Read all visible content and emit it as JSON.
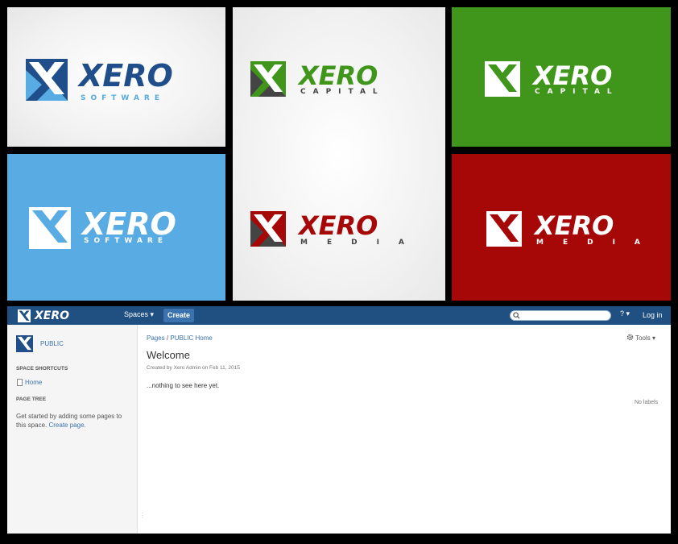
{
  "logos": {
    "p1": {
      "word": "XERO",
      "sub": "SOFTWARE"
    },
    "p2a": {
      "word": "XERO",
      "sub": "CAPITAL"
    },
    "p2b": {
      "word": "XERO",
      "sub": "MEDIA"
    },
    "p3": {
      "word": "XERO",
      "sub": "CAPITAL"
    },
    "p4": {
      "word": "XERO",
      "sub": "SOFTWARE"
    },
    "p6": {
      "word": "XERO",
      "sub": "MEDIA"
    }
  },
  "colors": {
    "navy": "#1f4e8b",
    "sky": "#58abe3",
    "green": "#3f961a",
    "red": "#a50807",
    "gray": "#444444",
    "bar": "#205081"
  },
  "app": {
    "brand": "XERO",
    "nav": {
      "spaces": "Spaces ▾",
      "create": "Create",
      "help": "? ▾",
      "login": "Log in"
    },
    "search": {
      "placeholder": ""
    },
    "sidebar": {
      "space_name": "PUBLIC",
      "shortcuts_heading": "SPACE SHORTCUTS",
      "home": "Home",
      "tree_heading": "PAGE TREE",
      "tree_text": "Get started by adding some pages to this space.",
      "create_link": "Create page."
    },
    "page": {
      "crumb1": "Pages",
      "crumb_sep": "/",
      "crumb2": "PUBLIC Home",
      "tools": "Tools ▾",
      "title": "Welcome",
      "meta": "Created by Xero Admin on Feb 11, 2015",
      "body": "...nothing to see here yet.",
      "labels": "No labels"
    }
  }
}
